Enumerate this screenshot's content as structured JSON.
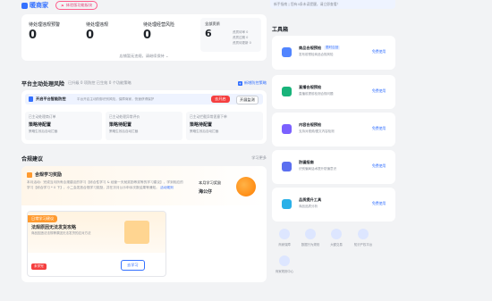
{
  "header": {
    "brand": "暖商家",
    "badge": "体验版功能板块"
  },
  "stats": {
    "items": [
      {
        "label": "待处理违规预警",
        "value": "0"
      },
      {
        "label": "待处理违规",
        "value": "0"
      },
      {
        "label": "待处理经营风险",
        "value": "0"
      }
    ],
    "score": {
      "label": "全部资质",
      "value": "6",
      "rows": [
        "资质待审 0",
        "资质过期 0",
        "资质待更新 0"
      ]
    },
    "expand": "店铺暂无违规，请继续保持"
  },
  "risk": {
    "title": "平台主动处理风险",
    "summary": "已升级 0 项防控 已生效 0 个功能策略",
    "new_link": "新增防控策略",
    "banner_title": "开启平台智能防控",
    "banner_desc": "平台开启主动防御识别风险，保障商家，快速获得保护",
    "banner_btn": "去开启",
    "banner_btn2": "开展监测",
    "cols": [
      {
        "head": "已主动处理商订单",
        "value": "策略待配置",
        "desc": "策略生效后自动拦截"
      },
      {
        "head": "已主动处理异常评价",
        "value": "策略待配置",
        "desc": "策略生效后自动拦截"
      },
      {
        "head": "已主动拦截异常恶意下单",
        "value": "策略待配置",
        "desc": "策略生效后自动拦截"
      }
    ]
  },
  "compliance": {
    "title": "合规建议",
    "more": "学习更多",
    "reward_title": "合规学习奖励",
    "reward_desc": "本月活动：完成当月所有合规建议的学习【综合性学习 & 经营一天就奖励等奖等的学习建议】，学到相应的学习【综合学习 * 0 下】，小二会发放合规学习奖励，并在次月公示申诉次数结果等通知。",
    "reward_link": "活动规则",
    "reward_right_title": "本月学习奖励",
    "reward_right_value": "海公仔",
    "daily_tag": "日常学习建议",
    "lesson_title": "法规原因无法发货攻略",
    "lesson_desc": "商品因违法法规等原因无法发货的应对方法",
    "lesson_badge": "未学完",
    "lesson_btn": "去学习"
  },
  "top_notice": {
    "text": "新手指南 | 您有4条未读提醒，请立即查看！"
  },
  "toolbox": {
    "title": "工具箱",
    "tools": [
      {
        "name": "商品合规预检",
        "tag": "限时召回",
        "desc": "发布前预检商品合规风险",
        "action": "免费使用",
        "color": "#3370ff"
      },
      {
        "name": "直播合规预检",
        "tag": "",
        "desc": "直播前提前检测合规问题",
        "action": "免费使用",
        "color": "#19b37a"
      },
      {
        "name": "内容合规预检",
        "tag": "",
        "desc": "支持对视频/图文内容检测",
        "action": "免费使用",
        "color": "#7b61ff"
      },
      {
        "name": "防骗指南",
        "tag": "",
        "desc": "识别骗局话术提升防骗意识",
        "action": "免费使用",
        "color": "#5b6ff0"
      },
      {
        "name": "品质提升工具",
        "tag": "",
        "desc": "商品品质分析",
        "action": "免费使用",
        "color": "#2ab0e8"
      }
    ],
    "shortcuts": [
      {
        "label": "商家保障"
      },
      {
        "label": "数据行为规则"
      },
      {
        "label": "大额交易"
      },
      {
        "label": "知识产权平台"
      },
      {
        "label": "商家规则中心"
      }
    ]
  },
  "colors": {
    "accent": "#3370ff",
    "danger": "#f53f3f",
    "warn": "#ff7d00"
  }
}
